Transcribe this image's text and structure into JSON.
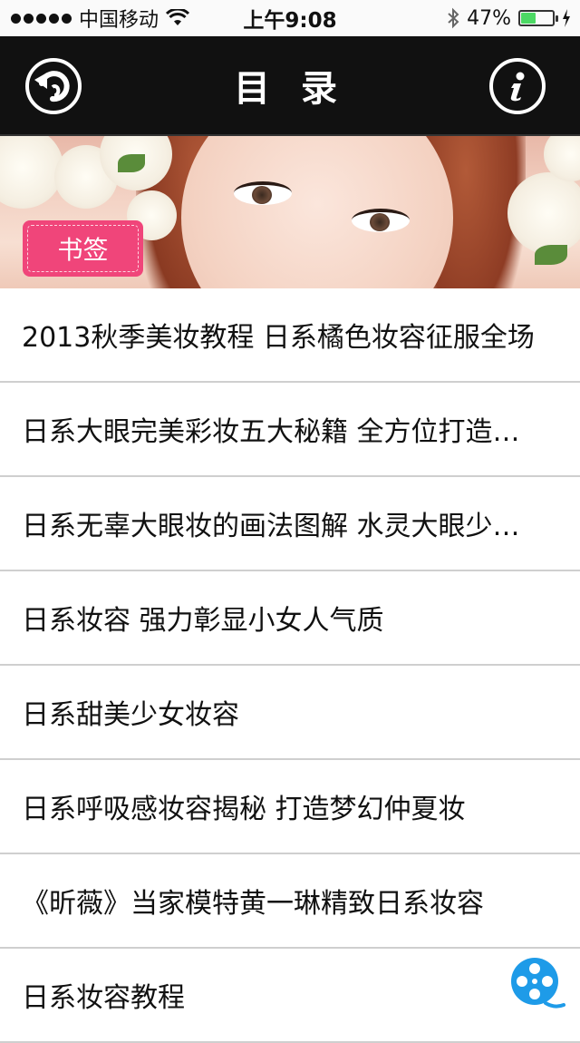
{
  "status_bar": {
    "carrier": "中国移动",
    "time": "上午9:08",
    "battery_percent": "47%",
    "battery_level": 0.47,
    "icons": [
      "signal-dots-icon",
      "wifi-icon",
      "bluetooth-icon",
      "battery-icon",
      "charging-icon"
    ]
  },
  "nav": {
    "title": "目 录",
    "back_icon": "back-arrow-icon",
    "info_icon": "info-icon"
  },
  "banner": {
    "bookmark_label": "书签"
  },
  "list": {
    "items": [
      {
        "label": "2013秋季美妆教程 日系橘色妆容征服全场"
      },
      {
        "label": "日系大眼完美彩妆五大秘籍 全方位打造…"
      },
      {
        "label": "日系无辜大眼妆的画法图解 水灵大眼少…"
      },
      {
        "label": "日系妆容 强力彰显小女人气质"
      },
      {
        "label": "日系甜美少女妆容"
      },
      {
        "label": "日系呼吸感妆容揭秘 打造梦幻仲夏妆"
      },
      {
        "label": "《昕薇》当家模特黄一琳精致日系妆容"
      },
      {
        "label": "日系妆容教程"
      }
    ]
  },
  "colors": {
    "nav_bg": "#111111",
    "bookmark_bg": "#f0457a",
    "fab_blue": "#1e9be8",
    "battery_green": "#4cd964"
  },
  "fab_icon": "film-reel-icon"
}
